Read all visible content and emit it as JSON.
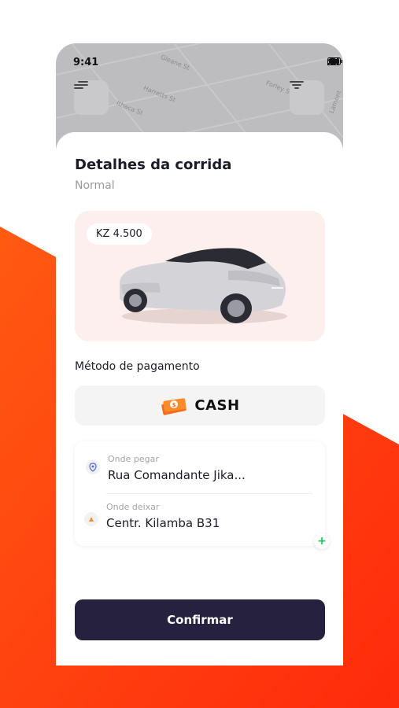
{
  "status_bar": {
    "time": "9:41"
  },
  "map": {
    "streets": [
      "Gleane St",
      "Harretts St",
      "Ithaca St",
      "Forley St",
      "Lamont"
    ],
    "menu_icon": "menu-icon",
    "filter_icon": "filter-icon"
  },
  "ride": {
    "title": "Detalhes da corrida",
    "subtitle": "Normal",
    "price": "KZ 4.500"
  },
  "payment": {
    "section_label": "Método de pagamento",
    "method": "CASH",
    "icon": "cash-icon"
  },
  "route": {
    "pickup_caption": "Onde pegar",
    "pickup_value": "Rua Comandante Jika...",
    "dropoff_caption": "Onde deixar",
    "dropoff_value": "Centr. Kilamba B31",
    "add_label": "+"
  },
  "actions": {
    "confirm_label": "Confirmar"
  },
  "colors": {
    "accent_orange": "#ff3d0f",
    "button_dark": "#26213f",
    "card_pink": "#fcefed",
    "add_green": "#27c15a"
  }
}
